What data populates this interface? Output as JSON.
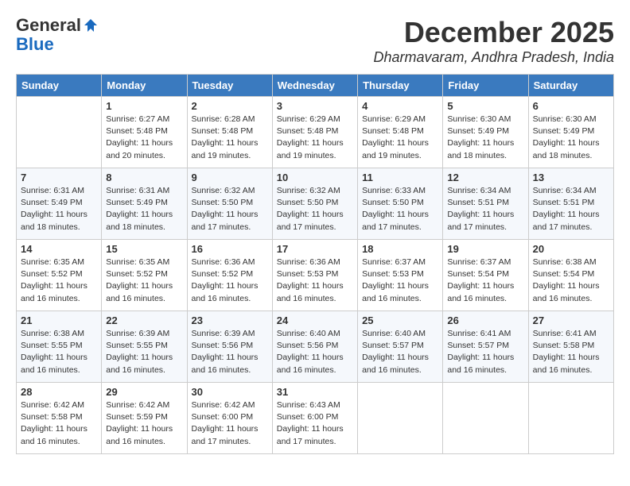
{
  "header": {
    "logo_general": "General",
    "logo_blue": "Blue",
    "month": "December 2025",
    "location": "Dharmavaram, Andhra Pradesh, India"
  },
  "days_of_week": [
    "Sunday",
    "Monday",
    "Tuesday",
    "Wednesday",
    "Thursday",
    "Friday",
    "Saturday"
  ],
  "weeks": [
    [
      {
        "day": "",
        "info": ""
      },
      {
        "day": "1",
        "info": "Sunrise: 6:27 AM\nSunset: 5:48 PM\nDaylight: 11 hours\nand 20 minutes."
      },
      {
        "day": "2",
        "info": "Sunrise: 6:28 AM\nSunset: 5:48 PM\nDaylight: 11 hours\nand 19 minutes."
      },
      {
        "day": "3",
        "info": "Sunrise: 6:29 AM\nSunset: 5:48 PM\nDaylight: 11 hours\nand 19 minutes."
      },
      {
        "day": "4",
        "info": "Sunrise: 6:29 AM\nSunset: 5:48 PM\nDaylight: 11 hours\nand 19 minutes."
      },
      {
        "day": "5",
        "info": "Sunrise: 6:30 AM\nSunset: 5:49 PM\nDaylight: 11 hours\nand 18 minutes."
      },
      {
        "day": "6",
        "info": "Sunrise: 6:30 AM\nSunset: 5:49 PM\nDaylight: 11 hours\nand 18 minutes."
      }
    ],
    [
      {
        "day": "7",
        "info": "Sunrise: 6:31 AM\nSunset: 5:49 PM\nDaylight: 11 hours\nand 18 minutes."
      },
      {
        "day": "8",
        "info": "Sunrise: 6:31 AM\nSunset: 5:49 PM\nDaylight: 11 hours\nand 18 minutes."
      },
      {
        "day": "9",
        "info": "Sunrise: 6:32 AM\nSunset: 5:50 PM\nDaylight: 11 hours\nand 17 minutes."
      },
      {
        "day": "10",
        "info": "Sunrise: 6:32 AM\nSunset: 5:50 PM\nDaylight: 11 hours\nand 17 minutes."
      },
      {
        "day": "11",
        "info": "Sunrise: 6:33 AM\nSunset: 5:50 PM\nDaylight: 11 hours\nand 17 minutes."
      },
      {
        "day": "12",
        "info": "Sunrise: 6:34 AM\nSunset: 5:51 PM\nDaylight: 11 hours\nand 17 minutes."
      },
      {
        "day": "13",
        "info": "Sunrise: 6:34 AM\nSunset: 5:51 PM\nDaylight: 11 hours\nand 17 minutes."
      }
    ],
    [
      {
        "day": "14",
        "info": "Sunrise: 6:35 AM\nSunset: 5:52 PM\nDaylight: 11 hours\nand 16 minutes."
      },
      {
        "day": "15",
        "info": "Sunrise: 6:35 AM\nSunset: 5:52 PM\nDaylight: 11 hours\nand 16 minutes."
      },
      {
        "day": "16",
        "info": "Sunrise: 6:36 AM\nSunset: 5:52 PM\nDaylight: 11 hours\nand 16 minutes."
      },
      {
        "day": "17",
        "info": "Sunrise: 6:36 AM\nSunset: 5:53 PM\nDaylight: 11 hours\nand 16 minutes."
      },
      {
        "day": "18",
        "info": "Sunrise: 6:37 AM\nSunset: 5:53 PM\nDaylight: 11 hours\nand 16 minutes."
      },
      {
        "day": "19",
        "info": "Sunrise: 6:37 AM\nSunset: 5:54 PM\nDaylight: 11 hours\nand 16 minutes."
      },
      {
        "day": "20",
        "info": "Sunrise: 6:38 AM\nSunset: 5:54 PM\nDaylight: 11 hours\nand 16 minutes."
      }
    ],
    [
      {
        "day": "21",
        "info": "Sunrise: 6:38 AM\nSunset: 5:55 PM\nDaylight: 11 hours\nand 16 minutes."
      },
      {
        "day": "22",
        "info": "Sunrise: 6:39 AM\nSunset: 5:55 PM\nDaylight: 11 hours\nand 16 minutes."
      },
      {
        "day": "23",
        "info": "Sunrise: 6:39 AM\nSunset: 5:56 PM\nDaylight: 11 hours\nand 16 minutes."
      },
      {
        "day": "24",
        "info": "Sunrise: 6:40 AM\nSunset: 5:56 PM\nDaylight: 11 hours\nand 16 minutes."
      },
      {
        "day": "25",
        "info": "Sunrise: 6:40 AM\nSunset: 5:57 PM\nDaylight: 11 hours\nand 16 minutes."
      },
      {
        "day": "26",
        "info": "Sunrise: 6:41 AM\nSunset: 5:57 PM\nDaylight: 11 hours\nand 16 minutes."
      },
      {
        "day": "27",
        "info": "Sunrise: 6:41 AM\nSunset: 5:58 PM\nDaylight: 11 hours\nand 16 minutes."
      }
    ],
    [
      {
        "day": "28",
        "info": "Sunrise: 6:42 AM\nSunset: 5:58 PM\nDaylight: 11 hours\nand 16 minutes."
      },
      {
        "day": "29",
        "info": "Sunrise: 6:42 AM\nSunset: 5:59 PM\nDaylight: 11 hours\nand 16 minutes."
      },
      {
        "day": "30",
        "info": "Sunrise: 6:42 AM\nSunset: 6:00 PM\nDaylight: 11 hours\nand 17 minutes."
      },
      {
        "day": "31",
        "info": "Sunrise: 6:43 AM\nSunset: 6:00 PM\nDaylight: 11 hours\nand 17 minutes."
      },
      {
        "day": "",
        "info": ""
      },
      {
        "day": "",
        "info": ""
      },
      {
        "day": "",
        "info": ""
      }
    ]
  ]
}
